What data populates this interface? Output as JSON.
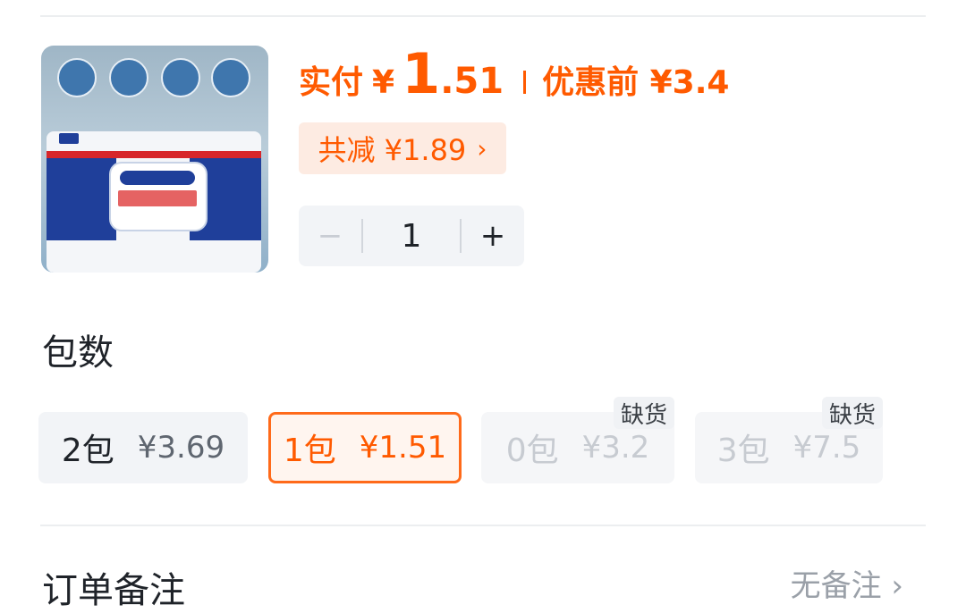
{
  "product": {
    "image_alt": "酒精湿巾",
    "pay_label": "实付",
    "currency": "¥",
    "price_integer": "1",
    "price_decimal": ".51",
    "before_label": "优惠前 ¥3.4",
    "discount_label": "共减 ¥1.89",
    "chevron_icon": "chevron-right-icon"
  },
  "stepper": {
    "minus_label": "−",
    "quantity": "1",
    "plus_label": "+"
  },
  "section": {
    "title": "包数"
  },
  "options": [
    {
      "name": "2包",
      "price": "¥3.69",
      "state": "normal",
      "tag": ""
    },
    {
      "name": "1包",
      "price": "¥1.51",
      "state": "selected",
      "tag": ""
    },
    {
      "name": "0包",
      "price": "¥3.2",
      "state": "disabled",
      "tag": "缺货"
    },
    {
      "name": "3包",
      "price": "¥7.5",
      "state": "disabled",
      "tag": "缺货"
    }
  ],
  "bottom": {
    "left_label": "订单备注",
    "right_label": "无备注 ›"
  },
  "colors": {
    "accent": "#ff5a00",
    "discount_bg": "#fdebe2",
    "stepper_bg": "#f2f4f7"
  }
}
